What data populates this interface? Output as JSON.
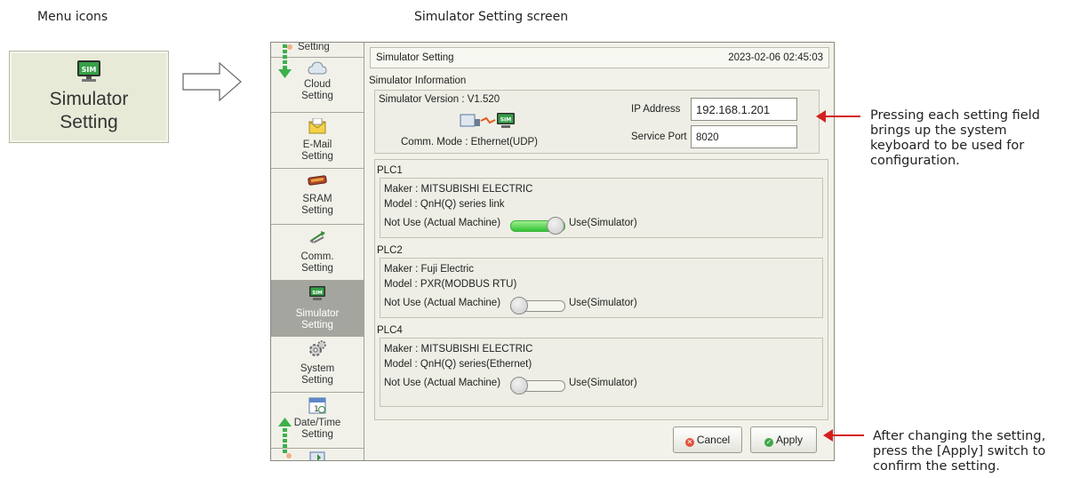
{
  "captions": {
    "menu_icons": "Menu icons",
    "screen": "Simulator Setting screen"
  },
  "menu_icon": {
    "badge": "SIM",
    "label_line1": "Simulator",
    "label_line2": "Setting"
  },
  "sidebar": {
    "items": [
      {
        "line1": "Setting",
        "line2": "",
        "icon": "gear-icon"
      },
      {
        "line1": "Cloud",
        "line2": "Setting",
        "icon": "cloud-icon"
      },
      {
        "line1": "E-Mail",
        "line2": "Setting",
        "icon": "mail-icon"
      },
      {
        "line1": "SRAM",
        "line2": "Setting",
        "icon": "sram-chip-icon"
      },
      {
        "line1": "Comm.",
        "line2": "Setting",
        "icon": "comm-arrows-icon"
      },
      {
        "line1": "Simulator",
        "line2": "Setting",
        "icon": "simulator-icon"
      },
      {
        "line1": "System",
        "line2": "Setting",
        "icon": "gears-icon"
      },
      {
        "line1": "Date/Time",
        "line2": "Setting",
        "icon": "calendar-icon"
      }
    ],
    "active_index": 5
  },
  "window": {
    "title": "Simulator Setting",
    "datetime": "2023-02-06  02:45:03"
  },
  "simulator_info": {
    "section": "Simulator Information",
    "version_label": "Simulator Version :  V1.520",
    "comm_mode_label": "Comm. Mode :  Ethernet(UDP)",
    "ip_label": "IP Address",
    "ip_value": "192.168.1.201",
    "port_label": "Service Port",
    "port_value": "8020",
    "sim_badge": "SIM"
  },
  "plcs": [
    {
      "name": "PLC1",
      "maker": "Maker :  MITSUBISHI ELECTRIC",
      "model": "Model :  QnH(Q) series link",
      "not_use": "Not Use (Actual Machine)",
      "use": "Use(Simulator)",
      "state": "on"
    },
    {
      "name": "PLC2",
      "maker": "Maker :  Fuji Electric",
      "model": "Model :  PXR(MODBUS RTU)",
      "not_use": "Not Use (Actual Machine)",
      "use": "Use(Simulator)",
      "state": "off"
    },
    {
      "name": "PLC4",
      "maker": "Maker :  MITSUBISHI ELECTRIC",
      "model": "Model :  QnH(Q) series(Ethernet)",
      "not_use": "Not Use (Actual Machine)",
      "use": "Use(Simulator)",
      "state": "off"
    }
  ],
  "buttons": {
    "cancel": "Cancel",
    "apply": "Apply"
  },
  "notes": {
    "fields_line1": "Pressing each setting field",
    "fields_line2": "brings up the system",
    "fields_line3": "keyboard to be used for",
    "fields_line4": "configuration.",
    "apply_line1": "After changing the setting,",
    "apply_line2": "press the [Apply] switch to",
    "apply_line3": "confirm the setting."
  },
  "colors": {
    "accent_red": "#d42020",
    "toggle_on": "#33c135",
    "active_sidebar": "#a5a5a0"
  }
}
